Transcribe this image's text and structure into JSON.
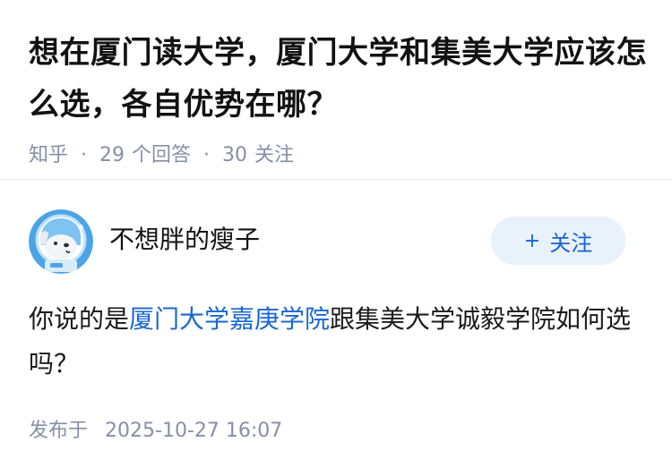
{
  "question": {
    "title": "想在厦门读大学，厦门大学和集美大学应该怎么选，各自优势在哪？",
    "source": "知乎",
    "answers_count": "29",
    "answers_label": "个回答",
    "followers_count": "30",
    "followers_label": "关注",
    "separator": "·"
  },
  "answer": {
    "author_name": "不想胖的瘦子",
    "follow_button": {
      "icon": "plus-icon",
      "plus": "+",
      "label": "关注"
    },
    "content": {
      "prefix": "你说的是",
      "link_text": "厦门大学嘉庚学院",
      "suffix": "跟集美大学诚毅学院如何选吗？"
    },
    "publish_label": "发布于",
    "publish_time": "2025-10-27 16:07"
  },
  "colors": {
    "title": "#121212",
    "meta": "#8590a6",
    "link": "#1967d2",
    "follow_bg": "#e9f1fb",
    "follow_text": "#1763d3",
    "avatar_bg": "#4ca4e8"
  }
}
